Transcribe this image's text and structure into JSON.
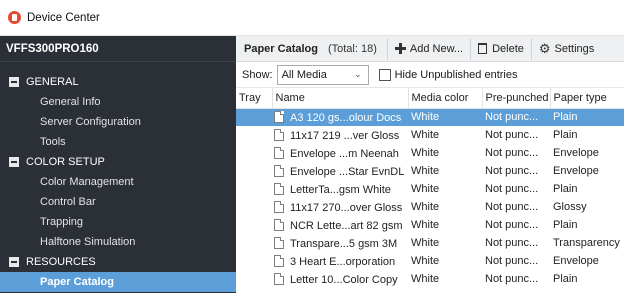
{
  "window": {
    "title": "Device Center"
  },
  "sidebar": {
    "server_name": "VFFS300PRO160",
    "sections": [
      {
        "label": "GENERAL",
        "items": [
          "General Info",
          "Server Configuration",
          "Tools"
        ]
      },
      {
        "label": "COLOR SETUP",
        "items": [
          "Color Management",
          "Control Bar",
          "Trapping",
          "Halftone Simulation"
        ]
      },
      {
        "label": "RESOURCES",
        "items": [
          "Paper Catalog"
        ]
      }
    ],
    "active_item": "Paper Catalog"
  },
  "toolbar": {
    "title": "Paper Catalog",
    "total": "(Total: 18)",
    "add_label": "Add New...",
    "delete_label": "Delete",
    "settings_label": "Settings"
  },
  "filter": {
    "show_label": "Show:",
    "show_value": "All Media",
    "hide_unpublished_label": "Hide Unpublished entries"
  },
  "table": {
    "columns": [
      "Tray",
      "Name",
      "Media color",
      "Pre-punched",
      "Paper type"
    ],
    "rows": [
      {
        "name": "A3 120 gs...olour Docs",
        "color": "White",
        "prepunched": "Not punc...",
        "type": "Plain",
        "selected": true
      },
      {
        "name": "11x17 219 ...ver Gloss",
        "color": "White",
        "prepunched": "Not punc...",
        "type": "Plain"
      },
      {
        "name": "Envelope ...m Neenah",
        "color": "White",
        "prepunched": "Not punc...",
        "type": "Envelope"
      },
      {
        "name": "Envelope ...Star EvnDL",
        "color": "White",
        "prepunched": "Not punc...",
        "type": "Envelope"
      },
      {
        "name": "LetterTa...gsm White",
        "color": "White",
        "prepunched": "Not punc...",
        "type": "Plain"
      },
      {
        "name": "11x17 270...over Gloss",
        "color": "White",
        "prepunched": "Not punc...",
        "type": "Glossy"
      },
      {
        "name": "NCR Lette...art 82 gsm",
        "color": "White",
        "prepunched": "Not punc...",
        "type": "Plain"
      },
      {
        "name": "Transpare...5 gsm 3M",
        "color": "White",
        "prepunched": "Not punc...",
        "type": "Transparency"
      },
      {
        "name": "3 Heart E...orporation",
        "color": "White",
        "prepunched": "Not punc...",
        "type": "Envelope"
      },
      {
        "name": "Letter 10...Color Copy",
        "color": "White",
        "prepunched": "Not punc...",
        "type": "Plain"
      }
    ]
  },
  "colors": {
    "sidebar_bg": "#2b2f36",
    "selection": "#5c9fd8",
    "app_icon": "#e64a2e"
  }
}
